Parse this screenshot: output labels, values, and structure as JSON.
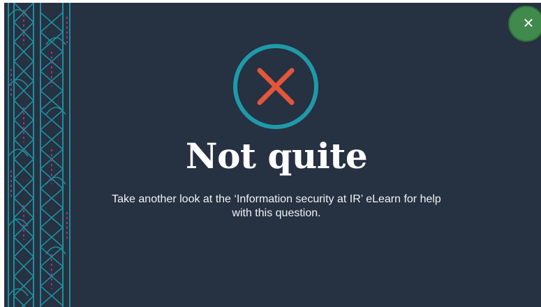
{
  "close_button": {
    "icon": "close-icon",
    "symbol": "✕",
    "color": "#3f8a4c"
  },
  "feedback": {
    "icon": "incorrect-x-icon",
    "title": "Not quite",
    "message": "Take another look at the ‘Information security at IR’ eLearn for help with this question."
  },
  "colors": {
    "background": "#263142",
    "ring": "#1e9aa8",
    "cross": "#e2563a",
    "pattern_line": "#1d8f9c",
    "pattern_accent": "#a3347a"
  }
}
